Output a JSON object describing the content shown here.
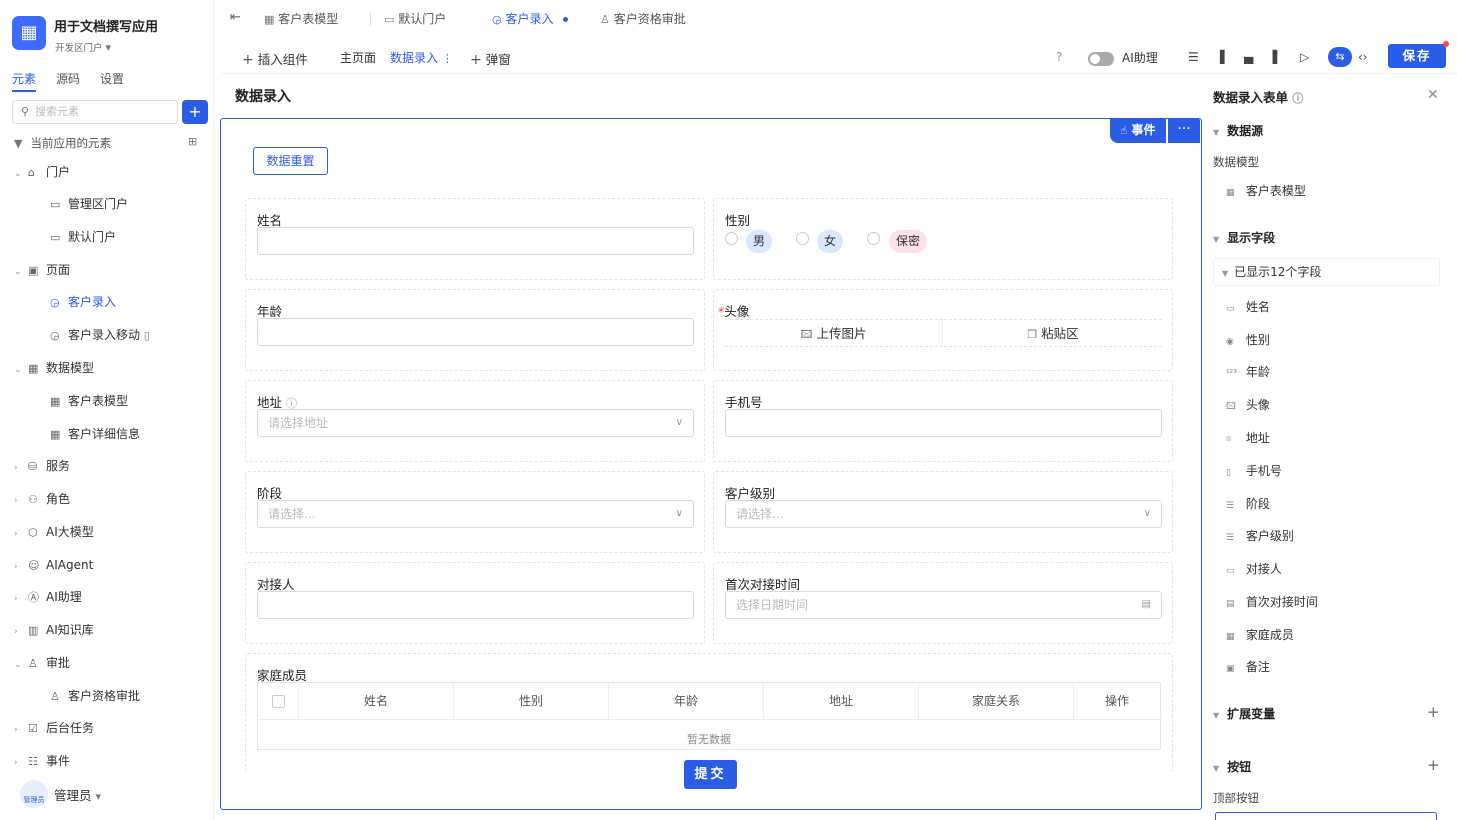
{
  "app": {
    "title": "用于文档撰写应用",
    "portal": "开发区门户"
  },
  "left_tabs": [
    "元素",
    "源码",
    "设置"
  ],
  "search_placeholder": "搜索元素",
  "tree_header": "当前应用的元素",
  "tree": [
    {
      "label": "门户"
    },
    {
      "label": "管理区门户"
    },
    {
      "label": "默认门户"
    },
    {
      "label": "页面"
    },
    {
      "label": "客户录入"
    },
    {
      "label": "客户录入移动"
    },
    {
      "label": "数据模型"
    },
    {
      "label": "客户表模型"
    },
    {
      "label": "客户详细信息"
    },
    {
      "label": "服务"
    },
    {
      "label": "角色"
    },
    {
      "label": "AI大模型"
    },
    {
      "label": "AIAgent"
    },
    {
      "label": "AI助理"
    },
    {
      "label": "AI知识库"
    },
    {
      "label": "审批"
    },
    {
      "label": "客户资格审批"
    },
    {
      "label": "后台任务"
    },
    {
      "label": "事件"
    }
  ],
  "admin": {
    "name": "管理员",
    "avatar_text": "管理员"
  },
  "tabs": [
    "客户表模型",
    "默认门户",
    "客户录入",
    "客户资格审批"
  ],
  "toolbar": {
    "insert": "插入组件",
    "home": "主页面",
    "current": "数据录入",
    "popup": "弹窗",
    "ai": "AI助理",
    "save": "保存"
  },
  "page_title": "数据录入",
  "event_btn": "事件",
  "reset_btn": "数据重置",
  "form": {
    "name_label": "姓名",
    "gender_label": "性别",
    "gender_options": [
      "男",
      "女",
      "保密"
    ],
    "age_label": "年龄",
    "avatar_label": "头像",
    "upload_label": "上传图片",
    "paste_label": "粘贴区",
    "address_label": "地址",
    "address_placeholder": "请选择地址",
    "phone_label": "手机号",
    "stage_label": "阶段",
    "stage_placeholder": "请选择...",
    "level_label": "客户级别",
    "level_placeholder": "请选择...",
    "contact_label": "对接人",
    "firsttime_label": "首次对接时间",
    "firsttime_placeholder": "选择日期时间",
    "family_label": "家庭成员",
    "family_columns": [
      "姓名",
      "性别",
      "年龄",
      "地址",
      "家庭关系",
      "操作"
    ],
    "empty_text": "暂无数据",
    "submit": "提交"
  },
  "right": {
    "title": "数据录入表单",
    "datasource": "数据源",
    "model_label": "数据模型",
    "model_value": "客户表模型",
    "display_fields": "显示字段",
    "field_count": "已显示12个字段",
    "fields": [
      "姓名",
      "性别",
      "年龄",
      "头像",
      "地址",
      "手机号",
      "阶段",
      "客户级别",
      "对接人",
      "首次对接时间",
      "家庭成员",
      "备注"
    ],
    "ext_vars": "扩展变量",
    "buttons": "按钮",
    "top_buttons": "顶部按钮"
  },
  "colors": {
    "accent": "#2b5ce6",
    "tag_blue": "#d9e7ff",
    "tag_pink": "#fde1ea"
  }
}
